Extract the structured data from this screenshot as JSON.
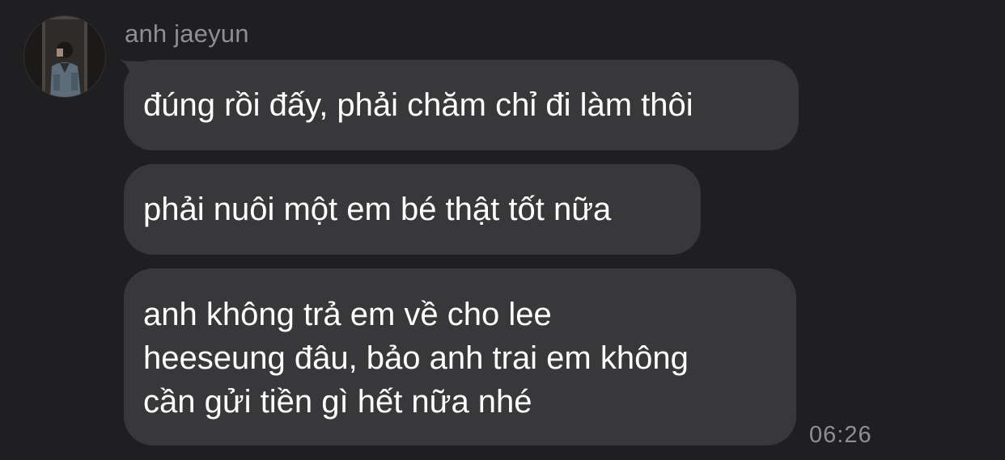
{
  "chat": {
    "sender_name": "anh jaeyun",
    "avatar_icon": "profile-photo",
    "messages": [
      {
        "text": "đúng rồi đấy, phải chăm chỉ đi làm thôi"
      },
      {
        "text": "phải nuôi một em bé thật tốt nữa"
      },
      {
        "lines": [
          "anh không trả em về cho lee",
          "heeseung đâu, bảo anh trai em không",
          "cần gửi tiền gì hết nữa nhé"
        ]
      }
    ],
    "timestamp": "06:26"
  },
  "colors": {
    "background": "#1f1f21",
    "bubble": "#38383a",
    "text": "#ffffff",
    "meta_text": "#8e8e93"
  }
}
